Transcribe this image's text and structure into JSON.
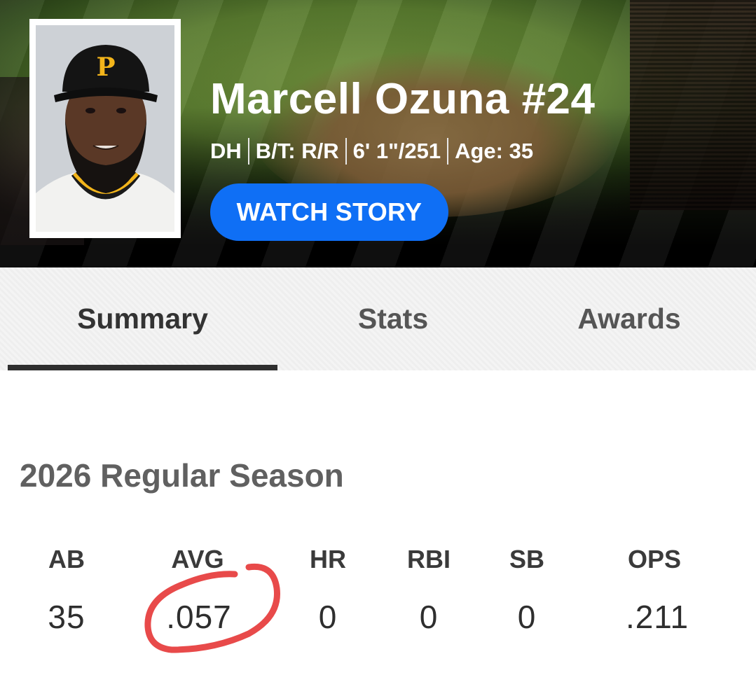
{
  "player": {
    "name": "Marcell Ozuna #24",
    "position": "DH",
    "bats_throws": "B/T: R/R",
    "height_weight": "6' 1\"/251",
    "age": "Age: 35",
    "photo_icon": "player-headshot",
    "cap_logo": "P"
  },
  "header": {
    "watch_story_label": "WATCH STORY",
    "accent_color": "#0f6ff5"
  },
  "tabs": [
    {
      "label": "Summary",
      "active": true
    },
    {
      "label": "Stats",
      "active": false
    },
    {
      "label": "Awards",
      "active": false
    }
  ],
  "season": {
    "title": "2026 Regular Season",
    "columns": [
      "AB",
      "AVG",
      "HR",
      "RBI",
      "SB",
      "OPS"
    ],
    "values": [
      "35",
      ".057",
      "0",
      "0",
      "0",
      ".211"
    ],
    "highlight_color": "#e84a4a"
  }
}
